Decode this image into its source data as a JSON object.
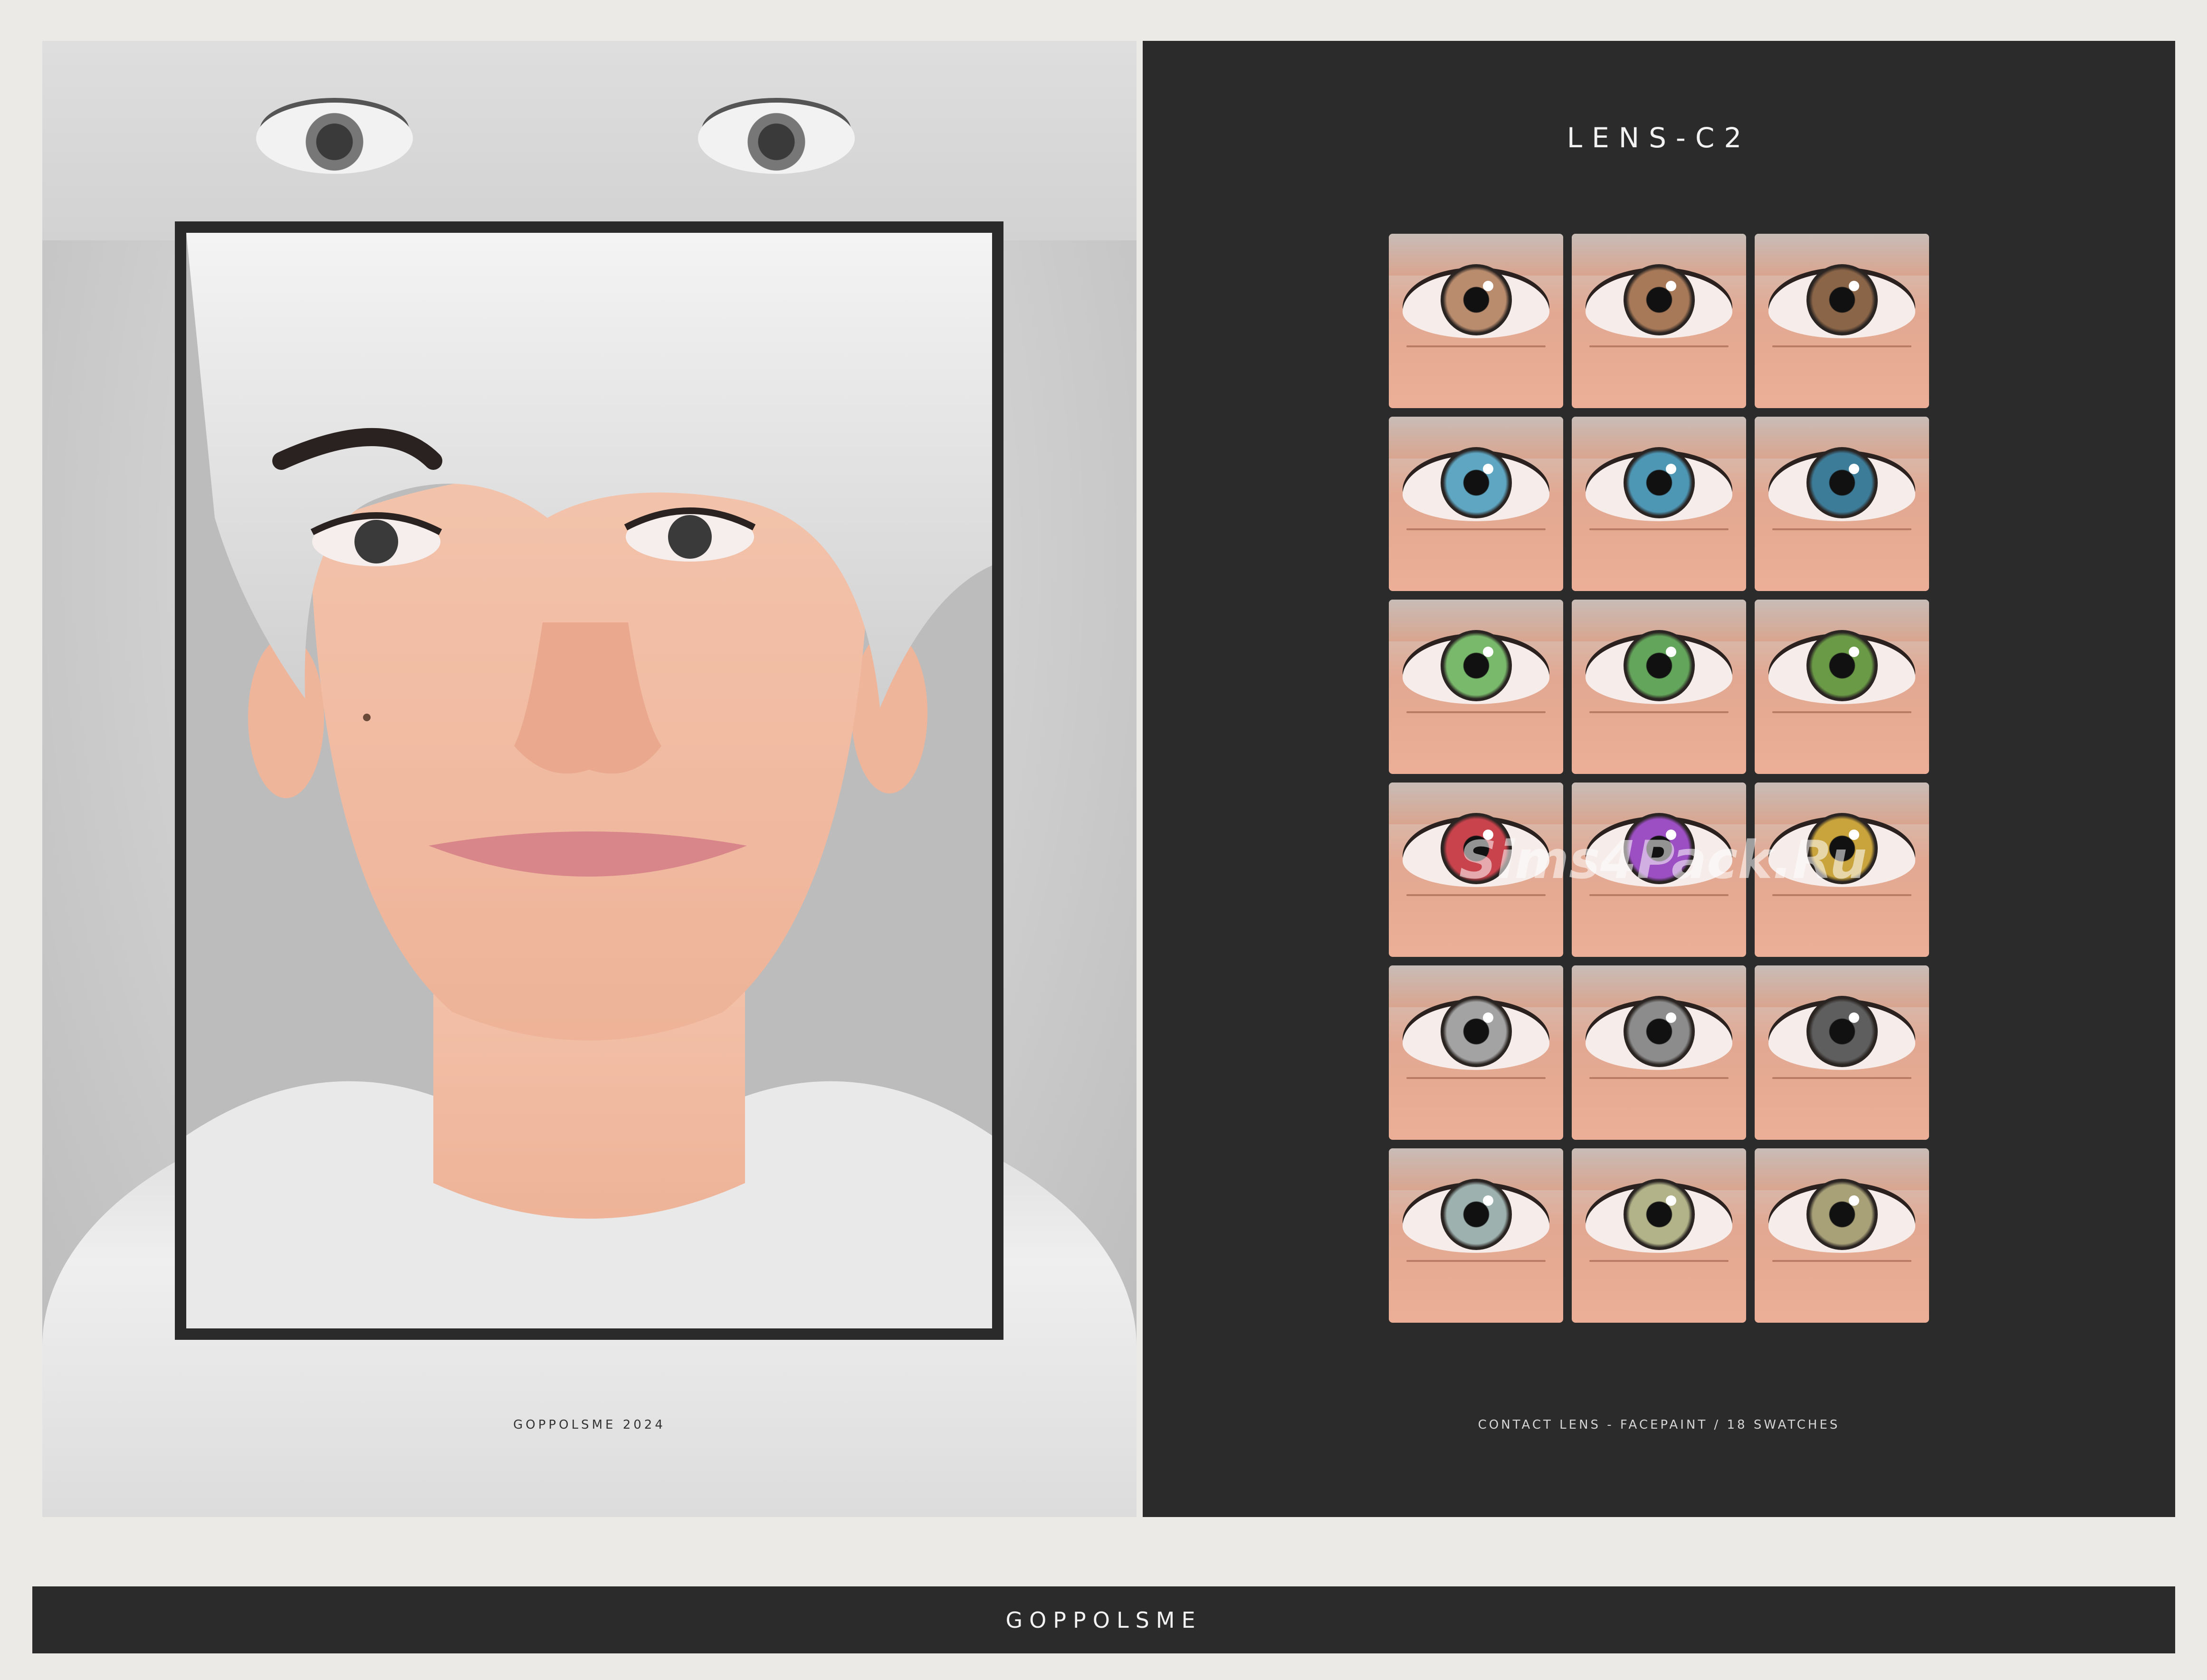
{
  "left_panel": {
    "credit": "GOPPOLSME 2024"
  },
  "right_panel": {
    "title": "LENS-C2",
    "watermark": "Sims4Pack.Ru",
    "caption": "CONTACT LENS - FACEPAINT / 18 SWATCHES",
    "swatches": [
      {
        "color": "#b98c6e"
      },
      {
        "color": "#a77958"
      },
      {
        "color": "#8a6548"
      },
      {
        "color": "#5ea6c2"
      },
      {
        "color": "#4d96b4"
      },
      {
        "color": "#3d7c98"
      },
      {
        "color": "#79b96b"
      },
      {
        "color": "#63a55a"
      },
      {
        "color": "#6a9a46"
      },
      {
        "color": "#c8434c"
      },
      {
        "color": "#9b4fc2"
      },
      {
        "color": "#c9a43c"
      },
      {
        "color": "#a3a3a3"
      },
      {
        "color": "#8c8c8c"
      },
      {
        "color": "#5e5e5e"
      },
      {
        "color": "#9db1ae"
      },
      {
        "color": "#b2b389"
      },
      {
        "color": "#a8a077"
      }
    ]
  },
  "footer": {
    "brand": "GOPPOLSME"
  }
}
